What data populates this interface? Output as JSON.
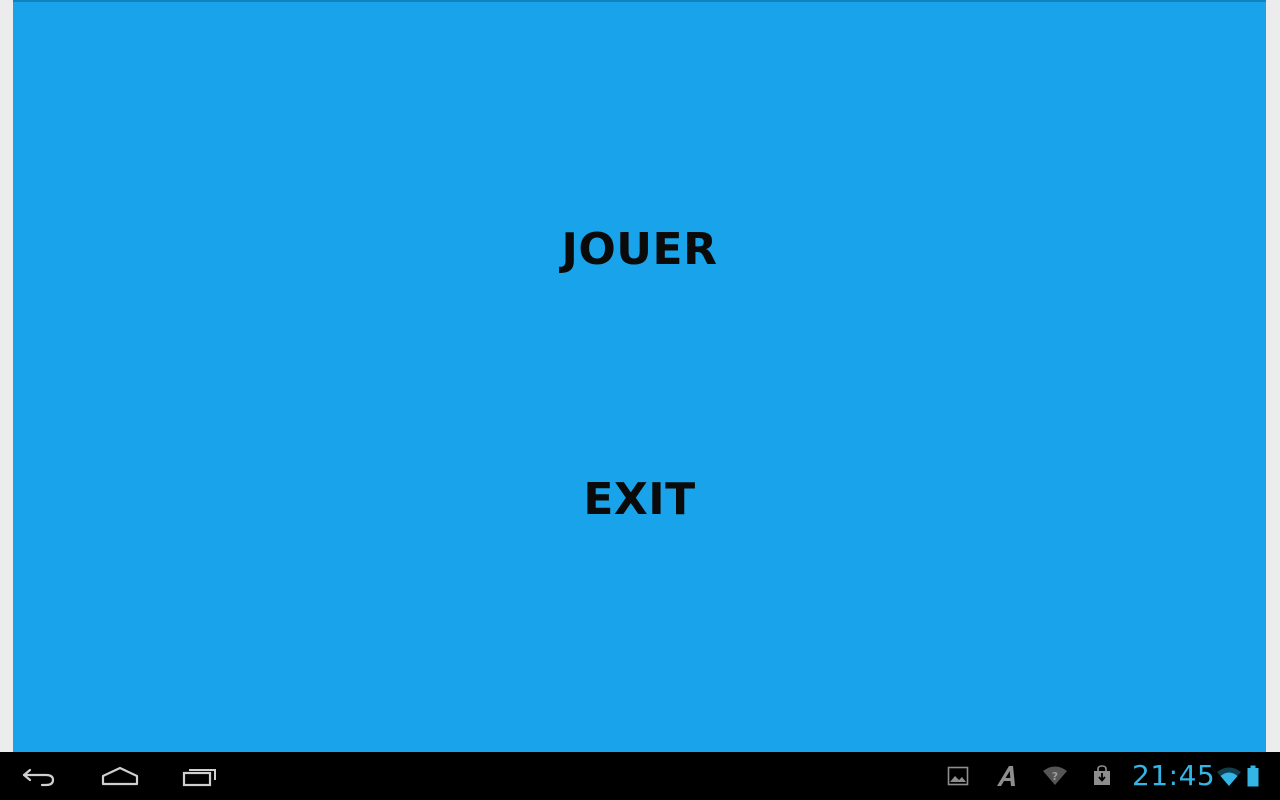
{
  "app": {
    "background_color": "#19a3ea",
    "buttons": {
      "play_label": "JOUER",
      "exit_label": "EXIT"
    }
  },
  "system_bar": {
    "nav": {
      "back_icon": "back-icon",
      "home_icon": "home-icon",
      "recent_icon": "recent-apps-icon"
    },
    "notifications": [
      "gallery-icon",
      "font-icon",
      "wifi-question-icon",
      "download-icon"
    ],
    "clock": "21:45",
    "clock_color": "#33b5e5",
    "status_icons": [
      "wifi-icon",
      "battery-icon"
    ]
  }
}
